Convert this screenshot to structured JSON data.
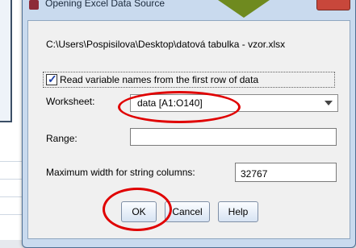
{
  "dialog": {
    "title": "Opening Excel Data Source"
  },
  "file_path": "C:\\Users\\Pospisilova\\Desktop\\datová tabulka - vzor.xlsx",
  "read_names": {
    "label": "Read variable names from the first row of data",
    "checked": true
  },
  "worksheet": {
    "label": "Worksheet:",
    "value": "data [A1:O140]"
  },
  "range": {
    "label": "Range:",
    "value": ""
  },
  "max_width": {
    "label": "Maximum width for string columns:",
    "value": "32767"
  },
  "buttons": {
    "ok": "OK",
    "cancel": "Cancel",
    "help": "Help"
  },
  "colors": {
    "annotation": "#e00000",
    "arrow": "#6f8a1f",
    "dialog_frame": "#c9daee"
  }
}
